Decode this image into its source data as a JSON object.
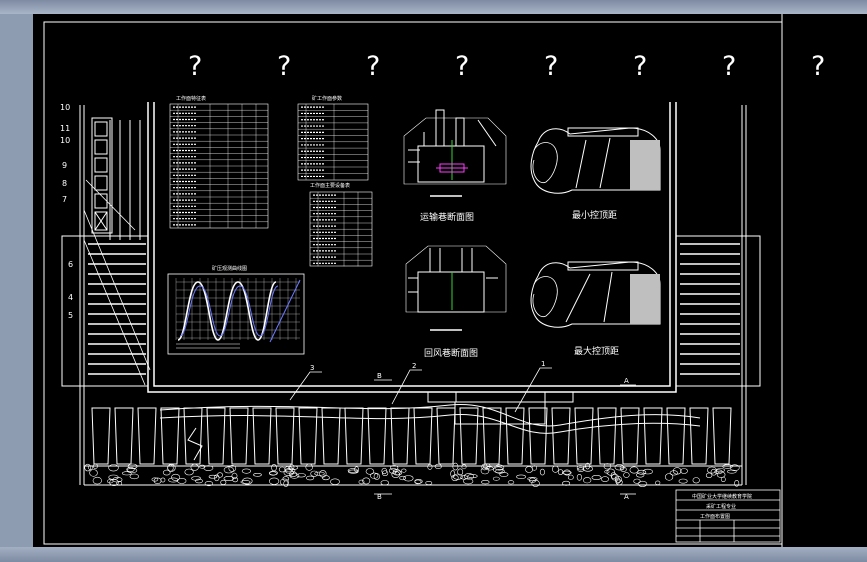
{
  "page": {
    "background": "#8e9cb2",
    "canvas_color": "#000000",
    "line_color": "#ffffff"
  },
  "markers": [
    "?",
    "?",
    "?",
    "?",
    "?",
    "?",
    "?",
    "?"
  ],
  "table1": {
    "title": "工作面特征表"
  },
  "table2": {
    "title": "矿工作面参数"
  },
  "table3": {
    "title": "工作面主要设备表"
  },
  "chart": {
    "title": "矿压观测曲线图"
  },
  "sections": {
    "s1": {
      "label": "运输巷断面图"
    },
    "s2": {
      "label": "最小控顶距"
    },
    "s3": {
      "label": "回风巷断面图"
    },
    "s4": {
      "label": "最大控顶距"
    }
  },
  "left_numbers": [
    "10",
    "11",
    "10",
    "9",
    "8",
    "7",
    "6",
    "4",
    "5",
    "4"
  ],
  "callouts": {
    "c1": "3",
    "c2": "2",
    "c3": "1",
    "a": "A",
    "b": "B"
  },
  "title_block": {
    "line1": "中国矿业大学继续教育学院",
    "line2": "采矿工程专业",
    "line3": "工作面布置图"
  }
}
